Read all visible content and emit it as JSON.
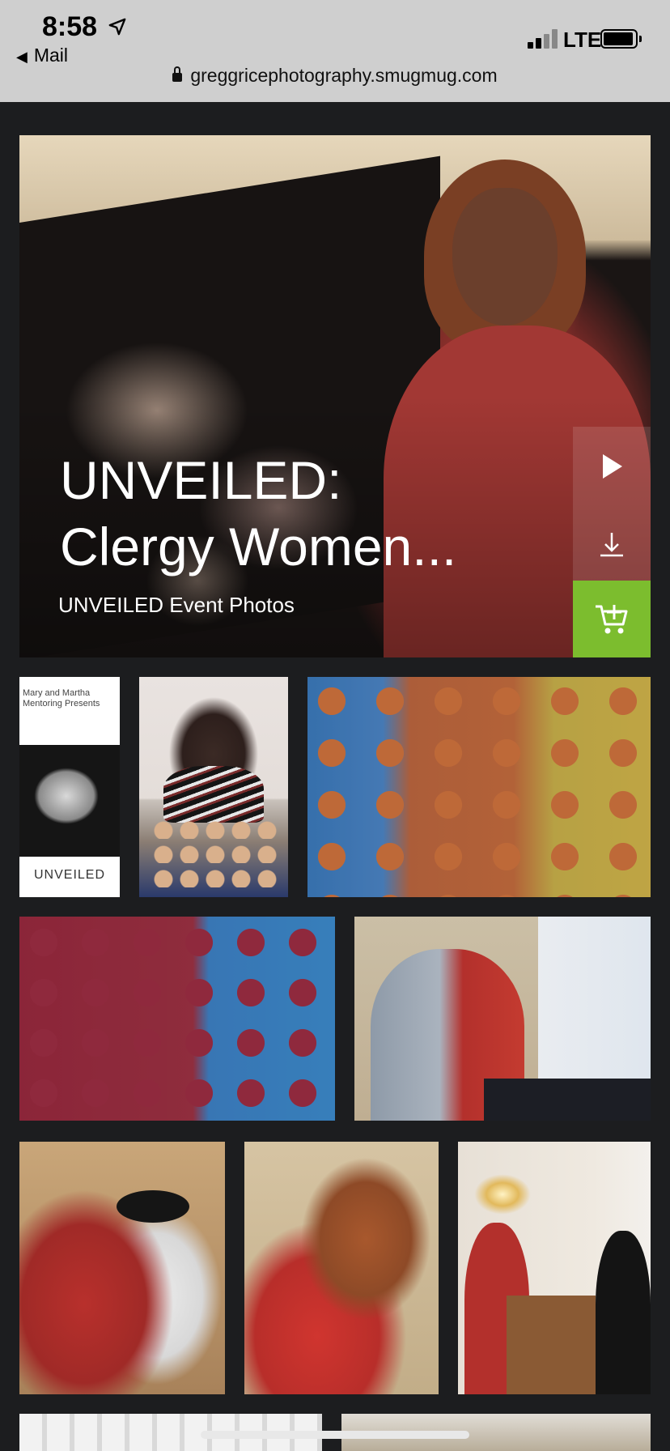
{
  "status_bar": {
    "time": "8:58",
    "back_app": "Mail",
    "network": "LTE",
    "url": "greggricephotography.smugmug.com"
  },
  "hero": {
    "title": "UNVEILED:\nClergy Women...",
    "subtitle": "UNVEILED Event Photos",
    "actions": [
      "play-icon",
      "download-icon",
      "cart-icon"
    ],
    "cart_color": "#7cbd2e"
  },
  "gallery": {
    "thumb1_caption": "Mary and Martha\nMentoring Presents",
    "thumb1_word": "UNVEILED"
  }
}
